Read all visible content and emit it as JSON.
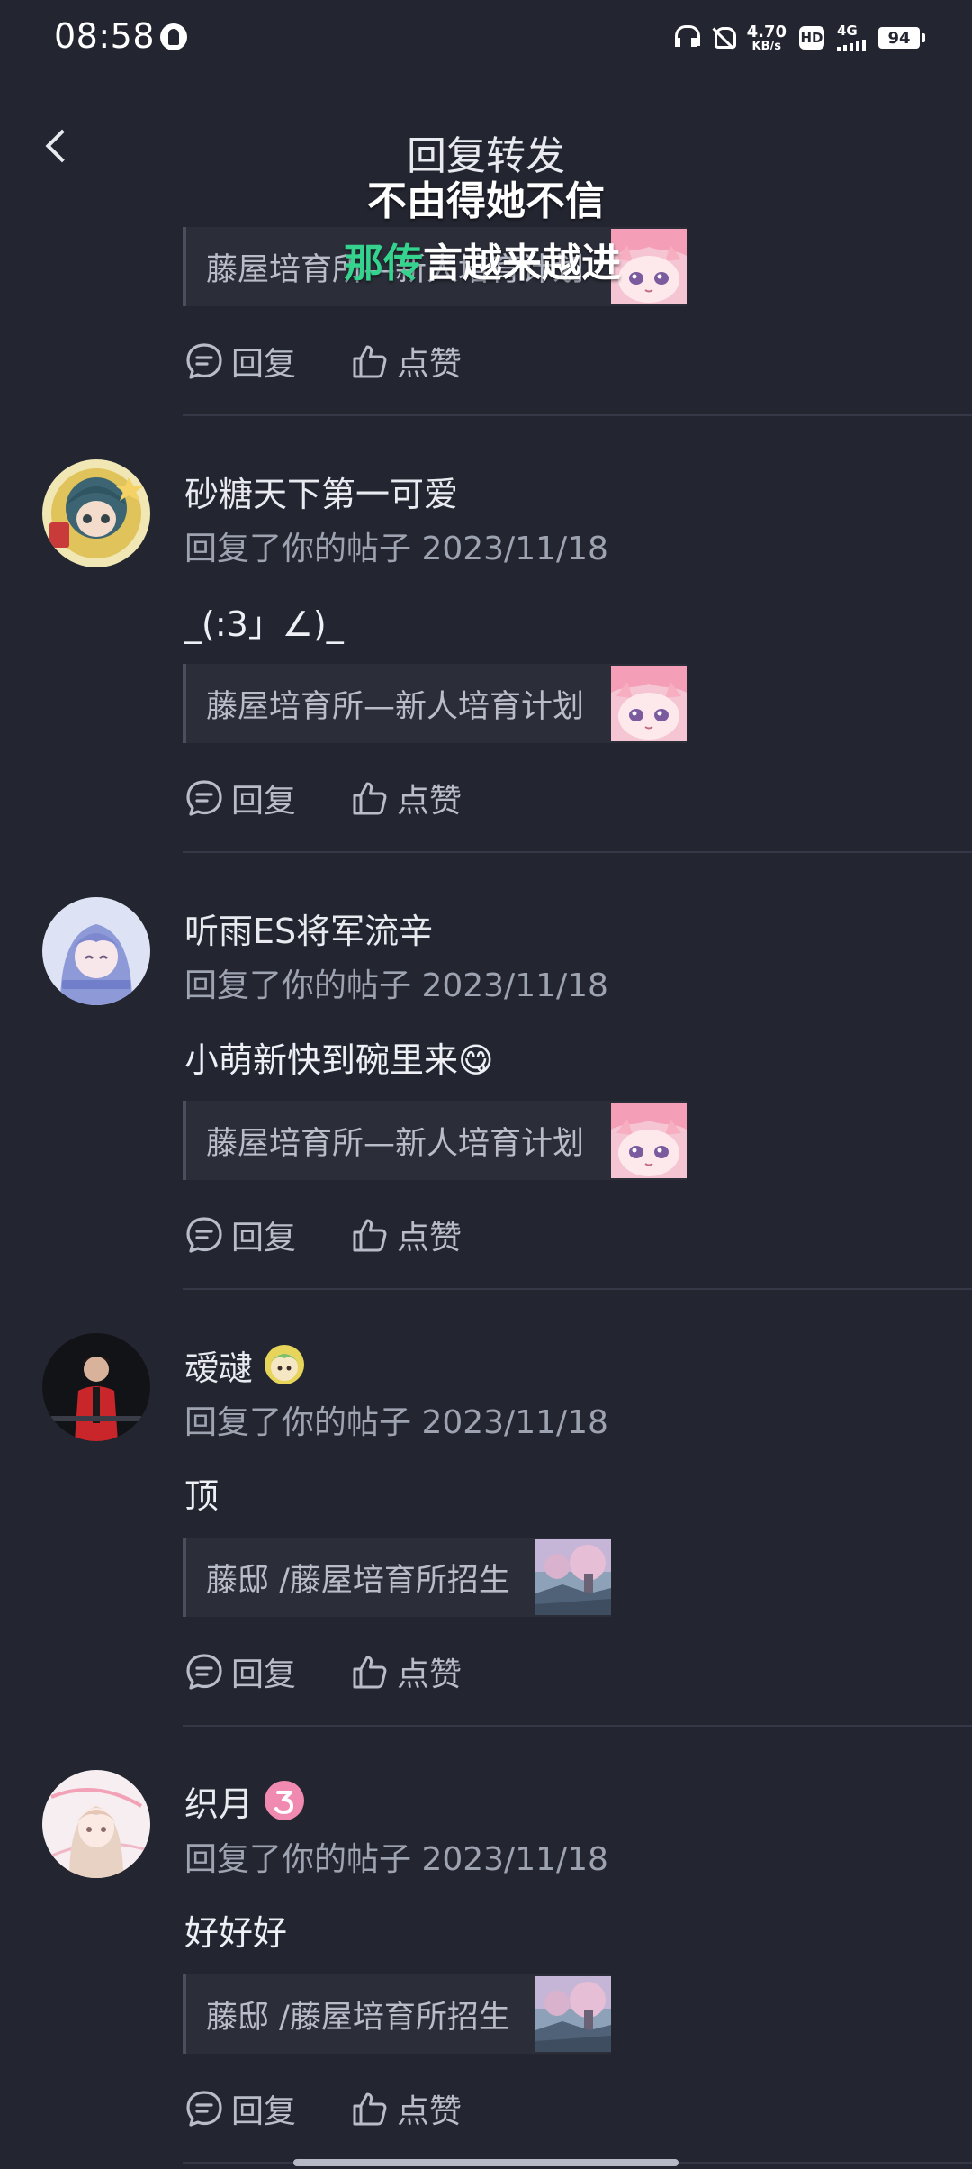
{
  "status_bar": {
    "time": "08:58",
    "net_speed": "4.70",
    "net_speed_unit": "KB/s",
    "hd": "HD",
    "network": "4G",
    "battery": "94"
  },
  "header": {
    "title": "回复转发"
  },
  "caption": {
    "line1": "不由得她不信",
    "line2_highlight": "那传",
    "line2_rest": "言越来越进"
  },
  "replies": [
    {
      "name": "",
      "meta": "",
      "body": "",
      "quote": "藤屋培育所—新人培育计划",
      "reply_label": "回复",
      "like_label": "点赞"
    },
    {
      "name": "砂糖天下第一可爱",
      "meta": "回复了你的帖子 2023/11/18",
      "body": "_(:3」∠)_",
      "quote": "藤屋培育所—新人培育计划",
      "reply_label": "回复",
      "like_label": "点赞"
    },
    {
      "name": "听雨ES将军流辛",
      "meta": "回复了你的帖子 2023/11/18",
      "body": "小萌新快到碗里来😋",
      "quote": "藤屋培育所—新人培育计划",
      "reply_label": "回复",
      "like_label": "点赞"
    },
    {
      "name": "叆叇",
      "meta": "回复了你的帖子 2023/11/18",
      "body": "顶",
      "quote": "藤邸 /藤屋培育所招生",
      "reply_label": "回复",
      "like_label": "点赞"
    },
    {
      "name": "织月",
      "meta": "回复了你的帖子 2023/11/18",
      "body": "好好好",
      "quote": "藤邸 /藤屋培育所招生",
      "reply_label": "回复",
      "like_label": "点赞"
    }
  ],
  "colors": {
    "background": "#232530",
    "quote_background": "#2b2d39",
    "muted_text": "#9ea3b2",
    "caption_highlight": "#35d48e"
  }
}
